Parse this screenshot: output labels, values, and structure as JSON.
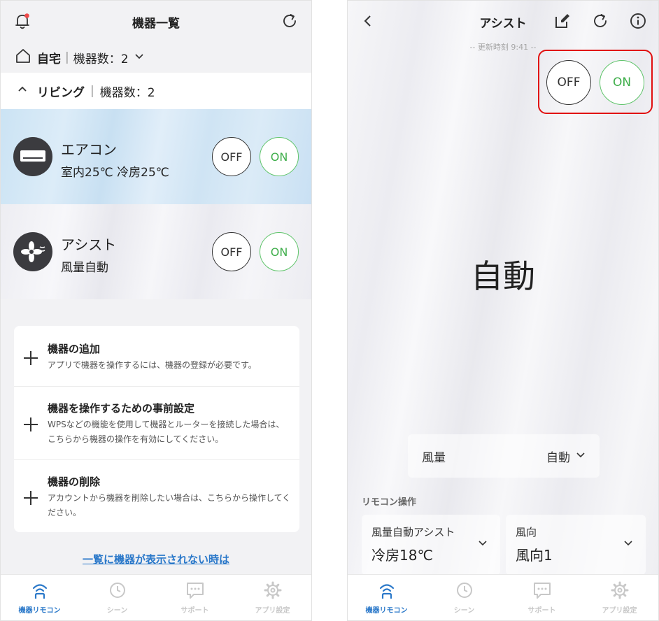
{
  "left": {
    "header_title": "機器一覧",
    "home": {
      "name": "自宅",
      "separator": "|",
      "count": "機器数：2"
    },
    "room": {
      "name": "リビング",
      "separator": "|",
      "count": "機器数：2"
    },
    "devices": [
      {
        "name": "エアコン",
        "status": "室内25℃  冷房25℃",
        "off_label": "OFF",
        "on_label": "ON"
      },
      {
        "name": "アシスト",
        "status": "風量自動",
        "off_label": "OFF",
        "on_label": "ON"
      }
    ],
    "actions": [
      {
        "title": "機器の追加",
        "desc": "アプリで機器を操作するには、機器の登録が必要です。"
      },
      {
        "title": "機器を操作するための事前設定",
        "desc": "WPSなどの機能を使用して機器とルーターを接続した場合は、こちらから機器の操作を有効にしてください。"
      },
      {
        "title": "機器の削除",
        "desc": "アカウントから機器を削除したい場合は、こちらから操作してください。"
      }
    ],
    "help_link": "一覧に機器が表示されない時は"
  },
  "right": {
    "header_title": "アシスト",
    "updated": "-- 更新時刻 9:41 --",
    "off_label": "OFF",
    "on_label": "ON",
    "mode": "自動",
    "wind": {
      "label": "風量",
      "value": "自動"
    },
    "remote_label": "リモコン操作",
    "remote_cards": [
      {
        "label": "風量自動アシスト",
        "value": "冷房18℃"
      },
      {
        "label": "風向",
        "value": "風向1"
      }
    ]
  },
  "nav": {
    "items": [
      {
        "label": "機器リモコン",
        "icon": "wifi-device-icon",
        "active": true
      },
      {
        "label": "シーン",
        "icon": "clock-icon",
        "active": false
      },
      {
        "label": "サポート",
        "icon": "chat-icon",
        "active": false
      },
      {
        "label": "アプリ設定",
        "icon": "gear-icon",
        "active": false
      }
    ]
  },
  "colors": {
    "accent": "#2a78c9",
    "on_green": "#3fae4b",
    "highlight_red": "#e10f0f",
    "ac_card": "#cfe4f4"
  }
}
